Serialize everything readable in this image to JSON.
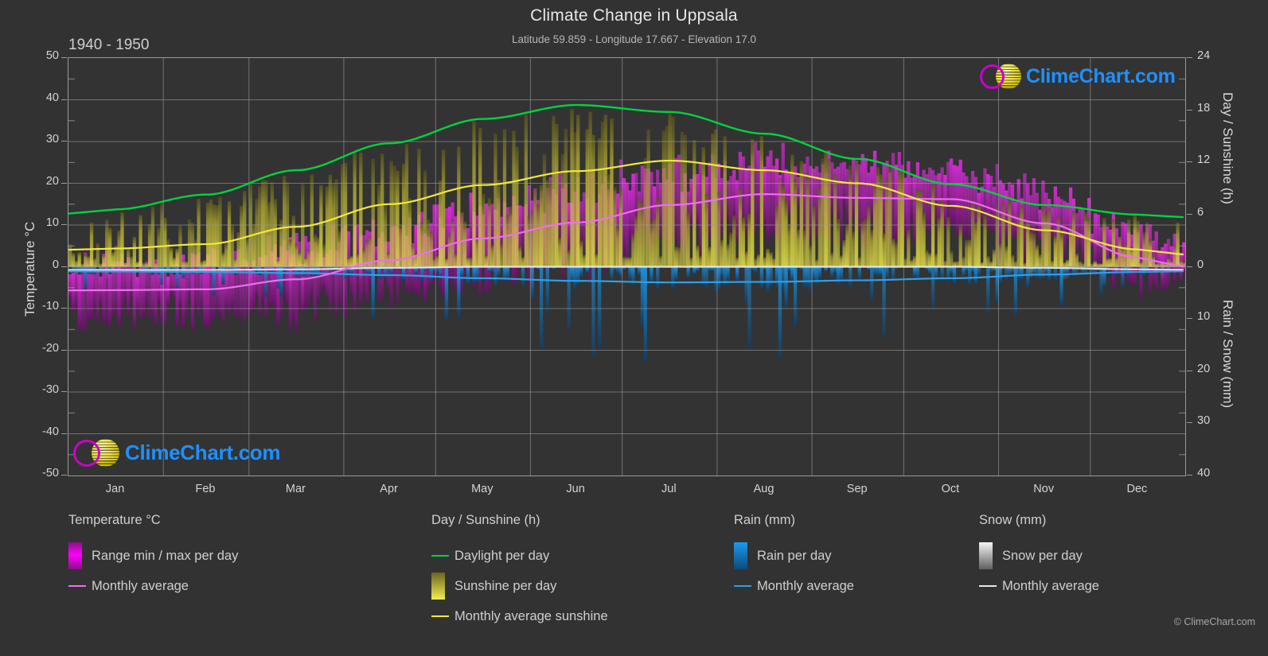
{
  "header": {
    "title": "Climate Change in Uppsala",
    "subtitle": "Latitude 59.859 - Longitude 17.667 - Elevation 17.0",
    "period": "1940 - 1950"
  },
  "logo": {
    "wordmark": "ClimeChart.com",
    "ring_color": "#cc00cc",
    "sphere_color": "#e8d63c",
    "text_color": "#1e90ff"
  },
  "copyright": "© ClimeChart.com",
  "axes": {
    "left_title": "Temperature °C",
    "left_ticks": [
      "50",
      "40",
      "30",
      "20",
      "10",
      "0",
      "-10",
      "-20",
      "-30",
      "-40",
      "-50"
    ],
    "right_top_title": "Day / Sunshine (h)",
    "right_top_ticks": [
      "24",
      "18",
      "12",
      "6",
      "0"
    ],
    "right_bottom_title": "Rain / Snow (mm)",
    "right_bottom_ticks": [
      "0",
      "10",
      "20",
      "30",
      "40"
    ],
    "x_ticks": [
      "Jan",
      "Feb",
      "Mar",
      "Apr",
      "May",
      "Jun",
      "Jul",
      "Aug",
      "Sep",
      "Oct",
      "Nov",
      "Dec"
    ]
  },
  "legend": {
    "columns": [
      {
        "heading": "Temperature °C",
        "items": [
          {
            "label": "Range min / max per day",
            "swatch": "gradient-box",
            "color": "#ff00ff",
            "color2": "#8a0f8a"
          },
          {
            "label": "Monthly average",
            "swatch": "line",
            "color": "#ee6eee"
          }
        ]
      },
      {
        "heading": "Day / Sunshine (h)",
        "items": [
          {
            "label": "Daylight per day",
            "swatch": "line",
            "color": "#00d43c"
          },
          {
            "label": "Sunshine per day",
            "swatch": "gradient-box",
            "color": "#f2ee4e",
            "color2": "#6b6520"
          },
          {
            "label": "Monthly average sunshine",
            "swatch": "line",
            "color": "#efe83e"
          }
        ]
      },
      {
        "heading": "Rain (mm)",
        "items": [
          {
            "label": "Rain per day",
            "swatch": "gradient-box",
            "color": "#1a9bf0",
            "color2": "#0b4a7a"
          },
          {
            "label": "Monthly average",
            "swatch": "line",
            "color": "#2f9fe8"
          }
        ]
      },
      {
        "heading": "Snow (mm)",
        "items": [
          {
            "label": "Snow per day",
            "swatch": "gradient-box",
            "color": "#f5f5f5",
            "color2": "#606060"
          },
          {
            "label": "Monthly average",
            "swatch": "line",
            "color": "#e8e8e8"
          }
        ]
      }
    ]
  },
  "chart_data": {
    "type": "line",
    "title": "Climate Change in Uppsala",
    "subtitle": "Latitude 59.859 - Longitude 17.667 - Elevation 17.0",
    "period": "1940 - 1950",
    "xlabel": "",
    "ylabel": "Temperature °C",
    "ylim": [
      -50,
      50
    ],
    "y2_top_label": "Day / Sunshine (h)",
    "y2_top_lim": [
      0,
      24
    ],
    "y2_bottom_label": "Rain / Snow (mm)",
    "y2_bottom_lim": [
      0,
      40
    ],
    "grid": true,
    "legend_position": "below",
    "categories": [
      "Jan",
      "Feb",
      "Mar",
      "Apr",
      "May",
      "Jun",
      "Jul",
      "Aug",
      "Sep",
      "Oct",
      "Nov",
      "Dec"
    ],
    "series": [
      {
        "name": "Daylight per day",
        "unit": "h",
        "axis": "right-top",
        "color": "#00d43c",
        "values": [
          6.6,
          8.3,
          11.1,
          14.2,
          17.0,
          18.6,
          17.8,
          15.3,
          12.4,
          9.5,
          7.1,
          6.0
        ]
      },
      {
        "name": "Monthly average sunshine",
        "unit": "h",
        "axis": "right-top",
        "color": "#efe83e",
        "values": [
          2.1,
          2.6,
          4.6,
          7.2,
          9.4,
          11.0,
          12.2,
          11.1,
          9.6,
          7.0,
          4.2,
          2.0
        ]
      },
      {
        "name": "Monthly average temperature",
        "unit": "°C",
        "axis": "left",
        "color": "#ee6eee",
        "values": [
          -5.6,
          -5.4,
          -3.0,
          1.6,
          6.8,
          10.6,
          14.8,
          17.4,
          16.5,
          16.2,
          10.4,
          2.2
        ]
      },
      {
        "name": "Monthly average rain",
        "unit": "mm",
        "axis": "right-bottom",
        "color": "#2f9fe8",
        "values": [
          0.9,
          1.0,
          1.2,
          1.6,
          2.2,
          2.7,
          3.0,
          2.9,
          2.6,
          2.2,
          1.5,
          1.0
        ]
      },
      {
        "name": "Monthly average snow",
        "unit": "mm",
        "axis": "right-bottom",
        "color": "#e8e8e8",
        "values": [
          0.6,
          0.6,
          0.5,
          0.2,
          0.0,
          0.0,
          0.0,
          0.0,
          0.0,
          0.0,
          0.2,
          0.5
        ]
      }
    ],
    "daily_bands": [
      {
        "name": "Range min / max per day",
        "axis": "left",
        "color_high": "#ff00ff",
        "color_low": "#7a0d7a"
      },
      {
        "name": "Sunshine per day",
        "axis": "right-top",
        "color_high": "#f2ee4e",
        "color_low": "#6b6520"
      },
      {
        "name": "Rain per day",
        "axis": "right-bottom",
        "color_high": "#1a9bf0",
        "color_low": "#0b4a7a"
      },
      {
        "name": "Snow per day",
        "axis": "right-bottom",
        "color_high": "#f5f5f5",
        "color_low": "#555555"
      }
    ]
  }
}
